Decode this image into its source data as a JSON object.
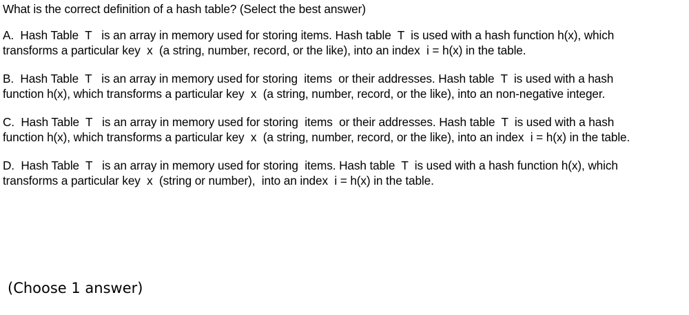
{
  "question": "What is the correct definition of a hash table? (Select the best answer)",
  "options": [
    {
      "text": "A.  Hash Table  T   is an array in memory used for storing items. Hash table  T  is used with a hash function h(x), which transforms a particular key  x  (a string, number, record, or the like), into an index  i = h(x) in the table."
    },
    {
      "text": "B.  Hash Table  T   is an array in memory used for storing  items  or their addresses. Hash table  T  is used with a hash function h(x), which transforms a particular key  x  (a string, number, record, or the like), into an non-negative integer."
    },
    {
      "text": "C.  Hash Table  T   is an array in memory used for storing  items  or their addresses. Hash table  T  is used with a hash function h(x), which transforms a particular key  x  (a string, number, record, or the like), into an index  i = h(x) in the table."
    },
    {
      "text": "D.  Hash Table  T   is an array in memory used for storing  items. Hash table  T  is used with a hash function h(x), which transforms a particular key  x  (string or number),  into an index  i = h(x) in the table."
    }
  ],
  "footer": "(Choose 1 answer)"
}
